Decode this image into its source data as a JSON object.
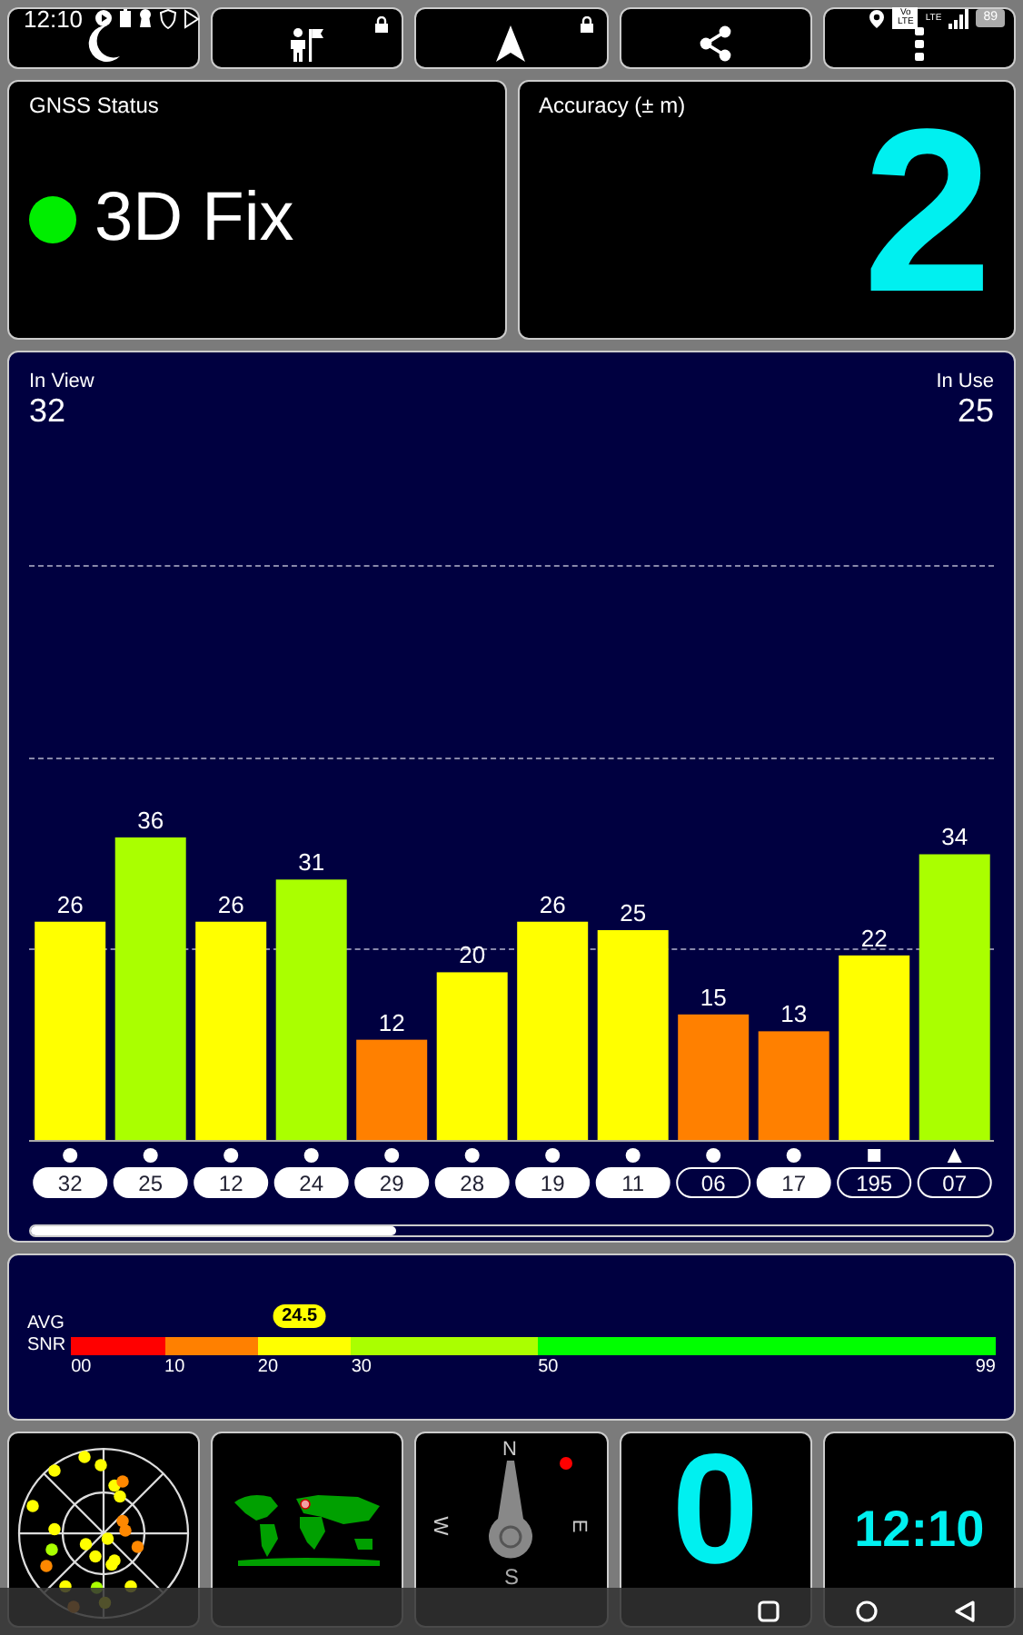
{
  "status_bar": {
    "time": "12:10",
    "network_labels": [
      "Vo LTE",
      "LTE"
    ],
    "battery": "89"
  },
  "toolbar": [
    {
      "kind": "moon",
      "locked": false
    },
    {
      "kind": "person-flag",
      "locked": true
    },
    {
      "kind": "navigation",
      "locked": true
    },
    {
      "kind": "share",
      "locked": false
    },
    {
      "kind": "more",
      "locked": false
    }
  ],
  "gnss_status": {
    "title": "GNSS Status",
    "fix": "3D Fix",
    "color": "#00ee00"
  },
  "accuracy": {
    "title": "Accuracy (± m)",
    "value": "2"
  },
  "signal_chart": {
    "in_view_label": "In View",
    "in_view": "32",
    "in_use_label": "In Use",
    "in_use": "25",
    "chart_data": {
      "type": "bar",
      "categories": [
        "32",
        "25",
        "12",
        "24",
        "29",
        "28",
        "19",
        "11",
        "06",
        "17",
        "195",
        "07"
      ],
      "values": [
        26,
        36,
        26,
        31,
        12,
        20,
        26,
        25,
        15,
        13,
        22,
        34
      ],
      "data_labels": true
    },
    "satellites": [
      {
        "kind": "circle",
        "in_use": true
      },
      {
        "kind": "circle",
        "in_use": true
      },
      {
        "kind": "circle",
        "in_use": true
      },
      {
        "kind": "circle",
        "in_use": true
      },
      {
        "kind": "circle",
        "in_use": true
      },
      {
        "kind": "circle",
        "in_use": true
      },
      {
        "kind": "circle",
        "in_use": true
      },
      {
        "kind": "circle",
        "in_use": true
      },
      {
        "kind": "circle",
        "in_use": false
      },
      {
        "kind": "circle",
        "in_use": true
      },
      {
        "kind": "square",
        "in_use": false
      },
      {
        "kind": "triangle",
        "in_use": false
      }
    ]
  },
  "snr": {
    "labels": [
      "AVG",
      "SNR"
    ],
    "value": "24.5",
    "level": 0.247,
    "segments": [
      {
        "color": "#ff0000"
      },
      {
        "color": "#ff8000"
      },
      {
        "color": "#ffff00"
      },
      {
        "color": "#aaff00"
      },
      {
        "color": "#00ff00"
      }
    ],
    "ticks": [
      "00",
      "10",
      "20",
      "30",
      "50",
      "99"
    ]
  },
  "tiles": [
    {
      "kind": "skyplot"
    },
    {
      "kind": "map"
    },
    {
      "kind": "compass",
      "labels": [
        "N",
        "W",
        "E",
        "S"
      ]
    },
    {
      "kind": "speed",
      "value": "0"
    },
    {
      "kind": "clock",
      "value": "12:10"
    }
  ]
}
